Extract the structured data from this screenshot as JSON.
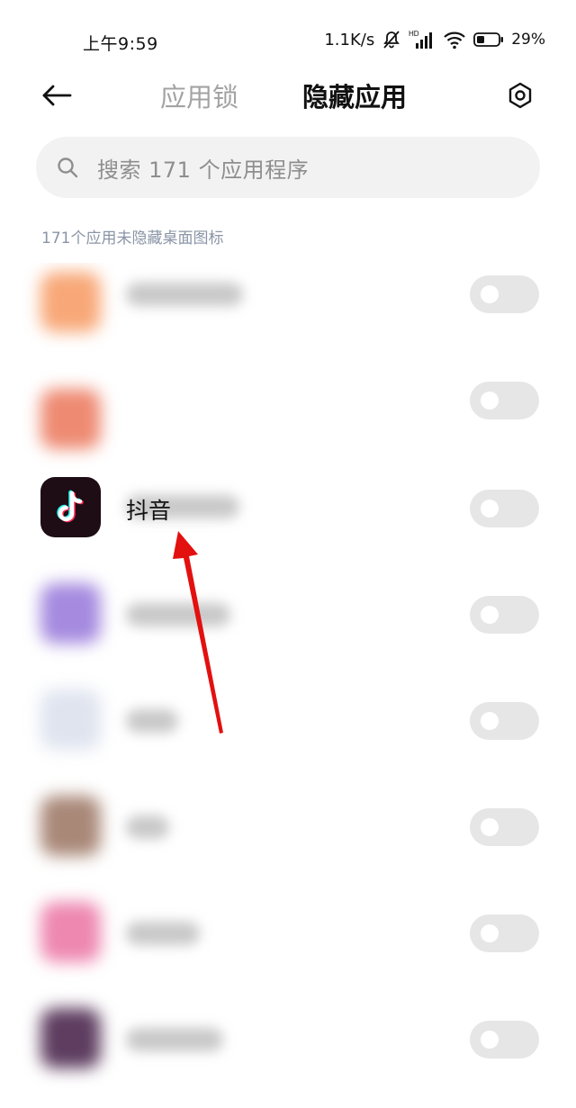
{
  "status": {
    "time": "上午9:59",
    "speed": "1.1K/s",
    "battery": "29%",
    "hd_label": "HD"
  },
  "nav": {
    "back_icon": "arrow-left-icon",
    "tab_applock": "应用锁",
    "tab_hidden": "隐藏应用",
    "settings_icon": "settings-gear-icon"
  },
  "search": {
    "placeholder": "搜索 171 个应用程序",
    "icon": "search-icon"
  },
  "section_label": "171个应用未隐藏桌面图标",
  "apps": [
    {
      "name": "",
      "blurred": true,
      "icon_color": "#f8a878",
      "toggle_on": false
    },
    {
      "name": "",
      "blurred": true,
      "icon_color": "#ee8a72",
      "toggle_on": false
    },
    {
      "name": "抖音",
      "blurred": false,
      "icon_color": "#1e0d15",
      "toggle_on": false
    },
    {
      "name": "",
      "blurred": true,
      "icon_color": "#a58adf",
      "toggle_on": false
    },
    {
      "name": "",
      "blurred": true,
      "icon_color": "#dfe4ef",
      "toggle_on": false
    },
    {
      "name": "",
      "blurred": true,
      "icon_color": "#a98878",
      "toggle_on": false
    },
    {
      "name": "",
      "blurred": true,
      "icon_color": "#ee88b0",
      "toggle_on": false
    },
    {
      "name": "",
      "blurred": true,
      "icon_color": "#5e3d60",
      "toggle_on": false
    }
  ],
  "colors": {
    "accent_arrow": "#e31010",
    "toggle_off": "#e6e6e6",
    "section_label": "#8a94a6"
  }
}
